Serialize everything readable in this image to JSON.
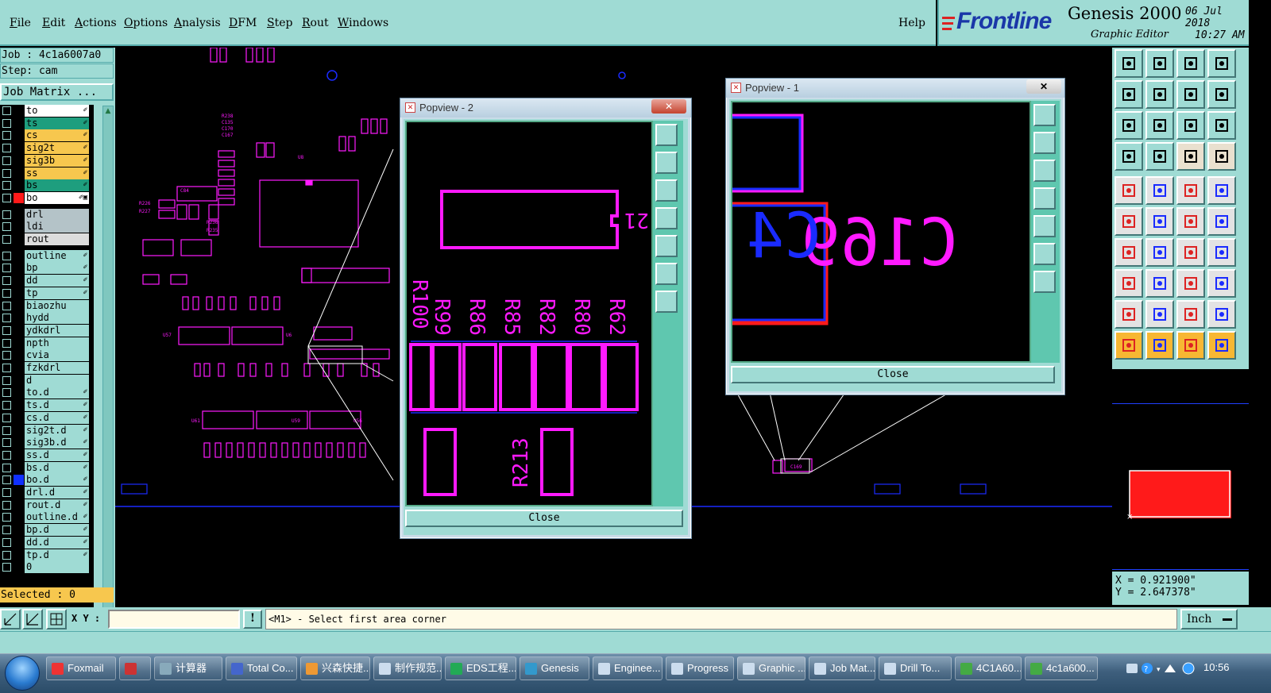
{
  "menubar": {
    "items": [
      "File",
      "Edit",
      "Actions",
      "Options",
      "Analysis",
      "DFM",
      "Step",
      "Rout",
      "Windows"
    ],
    "help": "Help"
  },
  "brand": {
    "logo": "Frontline",
    "product": "Genesis 2000",
    "subtitle": "Graphic Editor",
    "date": "06 Jul 2018",
    "time": "10:27 AM"
  },
  "job": {
    "job_label": "Job : 4c1a6007a0",
    "step_label": "Step: cam",
    "job_matrix_button": "Job Matrix ..."
  },
  "layers": [
    {
      "name": "to",
      "color": "#ffffff",
      "swatch": "#000000",
      "flag": "✐"
    },
    {
      "name": "ts",
      "color": "#1e9e7e",
      "swatch": "#000000",
      "flag": "✐"
    },
    {
      "name": "cs",
      "color": "#f7c74e",
      "swatch": "#000000",
      "flag": "✐"
    },
    {
      "name": "sig2t",
      "color": "#f7c74e",
      "swatch": "#000000",
      "flag": "✐"
    },
    {
      "name": "sig3b",
      "color": "#f7c74e",
      "swatch": "#000000",
      "flag": "✐"
    },
    {
      "name": "ss",
      "color": "#f7c74e",
      "swatch": "#000000",
      "flag": "✐"
    },
    {
      "name": "bs",
      "color": "#1e9e7e",
      "swatch": "#000000",
      "flag": "✐"
    },
    {
      "name": "bo",
      "color": "#ffffff",
      "swatch": "#ff1a1a",
      "flag": "✐▣"
    },
    {
      "name": "drl",
      "color": "#b4c3c8",
      "swatch": "#000000",
      "flag": ""
    },
    {
      "name": "ldi",
      "color": "#b4c3c8",
      "swatch": "#000000",
      "flag": ""
    },
    {
      "name": "rout",
      "color": "#dcdcdc",
      "swatch": "#000000",
      "flag": ""
    },
    {
      "name": "outline",
      "color": "#9fdbd4",
      "swatch": "#000000",
      "flag": "✐"
    },
    {
      "name": "bp",
      "color": "#9fdbd4",
      "swatch": "#000000",
      "flag": "✐"
    },
    {
      "name": "dd",
      "color": "#9fdbd4",
      "swatch": "#000000",
      "flag": "✐"
    },
    {
      "name": "tp",
      "color": "#9fdbd4",
      "swatch": "#000000",
      "flag": "✐"
    },
    {
      "name": "biaozhu",
      "color": "#9fdbd4",
      "swatch": "#000000",
      "flag": ""
    },
    {
      "name": "hydd",
      "color": "#9fdbd4",
      "swatch": "#000000",
      "flag": ""
    },
    {
      "name": "ydkdrl",
      "color": "#9fdbd4",
      "swatch": "#000000",
      "flag": ""
    },
    {
      "name": "npth",
      "color": "#9fdbd4",
      "swatch": "#000000",
      "flag": ""
    },
    {
      "name": "cvia",
      "color": "#9fdbd4",
      "swatch": "#000000",
      "flag": ""
    },
    {
      "name": "fzkdrl",
      "color": "#9fdbd4",
      "swatch": "#000000",
      "flag": ""
    },
    {
      "name": "d",
      "color": "#9fdbd4",
      "swatch": "#000000",
      "flag": ""
    },
    {
      "name": "to.d",
      "color": "#9fdbd4",
      "swatch": "#000000",
      "flag": "✐"
    },
    {
      "name": "ts.d",
      "color": "#9fdbd4",
      "swatch": "#000000",
      "flag": "✐"
    },
    {
      "name": "cs.d",
      "color": "#9fdbd4",
      "swatch": "#000000",
      "flag": "✐"
    },
    {
      "name": "sig2t.d",
      "color": "#9fdbd4",
      "swatch": "#000000",
      "flag": "✐"
    },
    {
      "name": "sig3b.d",
      "color": "#9fdbd4",
      "swatch": "#000000",
      "flag": "✐"
    },
    {
      "name": "ss.d",
      "color": "#9fdbd4",
      "swatch": "#000000",
      "flag": "✐"
    },
    {
      "name": "bs.d",
      "color": "#9fdbd4",
      "swatch": "#000000",
      "flag": "✐"
    },
    {
      "name": "bo.d",
      "color": "#9fdbd4",
      "swatch": "#1030ff",
      "flag": "✐"
    },
    {
      "name": "drl.d",
      "color": "#9fdbd4",
      "swatch": "#000000",
      "flag": "✐"
    },
    {
      "name": "rout.d",
      "color": "#9fdbd4",
      "swatch": "#000000",
      "flag": "✐"
    },
    {
      "name": "outline.d",
      "color": "#9fdbd4",
      "swatch": "#000000",
      "flag": "✐"
    },
    {
      "name": "bp.d",
      "color": "#9fdbd4",
      "swatch": "#000000",
      "flag": "✐"
    },
    {
      "name": "dd.d",
      "color": "#9fdbd4",
      "swatch": "#000000",
      "flag": "✐"
    },
    {
      "name": "tp.d",
      "color": "#9fdbd4",
      "swatch": "#000000",
      "flag": "✐"
    },
    {
      "name": "0",
      "color": "#9fdbd4",
      "swatch": "#000000",
      "flag": ""
    }
  ],
  "selected_label": "Selected : 0",
  "popview2": {
    "title": "Popview - 2",
    "close_label": "Close",
    "refdes": [
      "R100",
      "R99",
      "R86",
      "R85",
      "R82",
      "R80",
      "R62"
    ],
    "refdes_bottom": "R213",
    "refdes_side": "21"
  },
  "popview1": {
    "title": "Popview - 1",
    "close_label": "Close",
    "label_pink": "C169",
    "label_blue": "C4"
  },
  "coords": {
    "x_label": "X = 0.921900\"",
    "y_label": "Y = 2.647378\""
  },
  "status": {
    "xy_label": "X Y :",
    "xy_value": "",
    "warn_label": "!",
    "prompt": "<M1> - Select first area corner",
    "units": "Inch"
  },
  "taskbar": {
    "tasks": [
      {
        "label": "Foxmail",
        "icon_color": "#e33"
      },
      {
        "label": "",
        "icon_color": "#c33"
      },
      {
        "label": "计算器",
        "icon_color": "#8ab"
      },
      {
        "label": "Total Co...",
        "icon_color": "#46c"
      },
      {
        "label": "兴森快捷...",
        "icon_color": "#e93"
      },
      {
        "label": "制作规范...",
        "icon_color": "#cde"
      },
      {
        "label": "EDS工程...",
        "icon_color": "#2a5"
      },
      {
        "label": "Genesis",
        "icon_color": "#39c"
      },
      {
        "label": "Enginee...",
        "icon_color": "#cde"
      },
      {
        "label": "Progress",
        "icon_color": "#cde"
      },
      {
        "label": "Graphic ...",
        "icon_color": "#cde"
      },
      {
        "label": "Job Mat...",
        "icon_color": "#cde"
      },
      {
        "label": "Drill To...",
        "icon_color": "#cde"
      },
      {
        "label": "4C1A60...",
        "icon_color": "#4a4"
      },
      {
        "label": "4c1a600...",
        "icon_color": "#4a4"
      }
    ],
    "clock": "10:56"
  },
  "colors": {
    "panel": "#9fdbd4",
    "magenta": "#ff1aff",
    "blue": "#1a2bff",
    "red": "#ff1a1a",
    "yellow": "#f7c74e"
  }
}
